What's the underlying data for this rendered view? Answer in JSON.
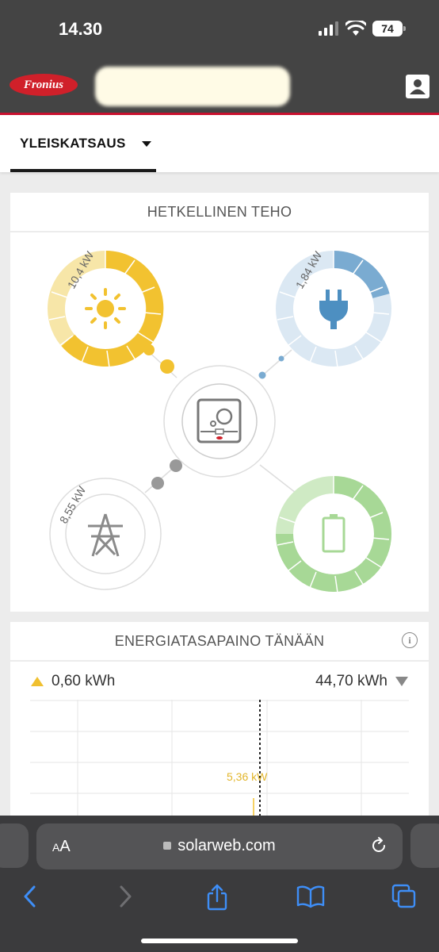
{
  "status_bar": {
    "time": "14.30",
    "battery": "74"
  },
  "header": {
    "logo_text": "Fronius"
  },
  "nav": {
    "tab_label": "YLEISKATSAUS"
  },
  "power_card": {
    "title": "HETKELLINEN TEHO",
    "solar_power": "10,4 kW",
    "grid_consumption_power": "1,84 kW",
    "grid_power": "8,55 kW",
    "colors": {
      "solar": "#f2c230",
      "consumption": "#8cb7d8",
      "grid": "#9a9a9a",
      "battery": "#9fd48c"
    }
  },
  "energy_card": {
    "title": "ENERGIATASAPAINO TÄNÄÄN",
    "produced": "0,60 kWh",
    "consumed": "44,70 kWh",
    "chart_peak_label": "5,36 kW"
  },
  "safari": {
    "aa_label": "AA",
    "url": "solarweb.com"
  }
}
